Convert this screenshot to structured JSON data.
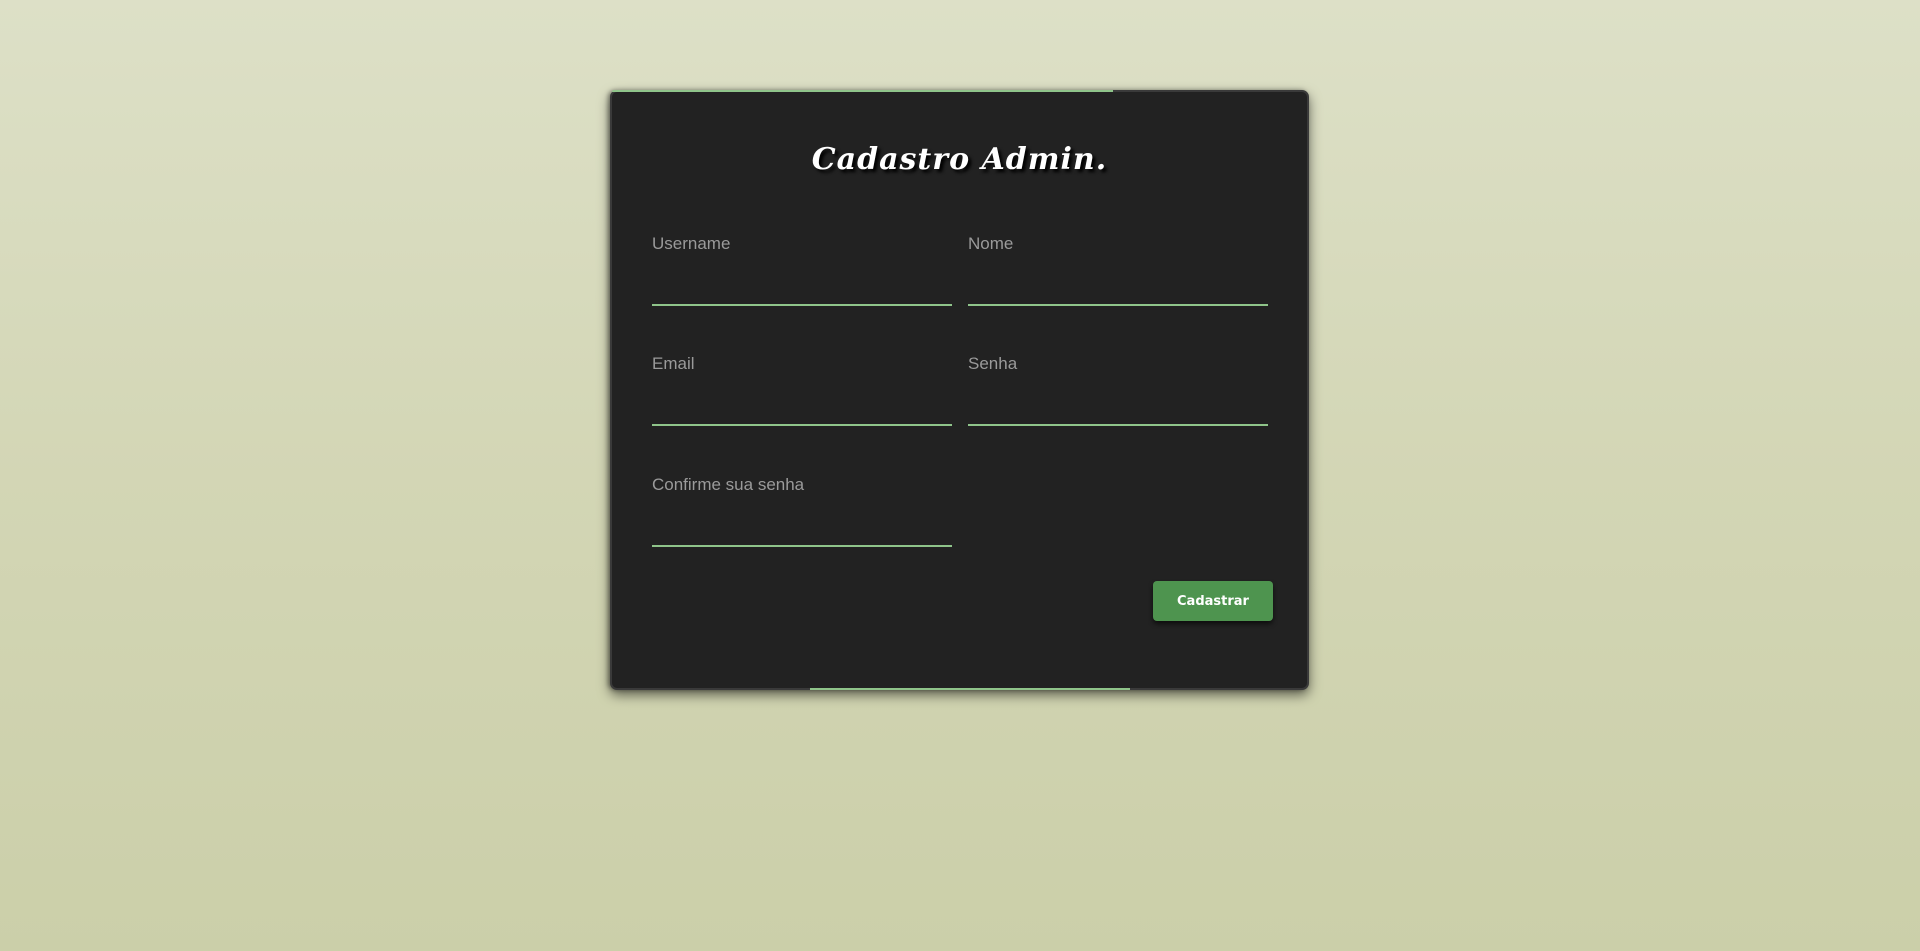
{
  "form": {
    "title": "Cadastro Admin.",
    "fields": {
      "username": {
        "label": "Username",
        "value": ""
      },
      "nome": {
        "label": "Nome",
        "value": ""
      },
      "email": {
        "label": "Email",
        "value": ""
      },
      "senha": {
        "label": "Senha",
        "value": ""
      },
      "confirm": {
        "label": "Confirme sua senha",
        "value": ""
      }
    },
    "submit_label": "Cadastrar"
  },
  "colors": {
    "accent": "#8fc48a",
    "button": "#4e944f",
    "card": "#222222",
    "background_top": "#dde0c7",
    "background_bottom": "#cbcfa9"
  }
}
